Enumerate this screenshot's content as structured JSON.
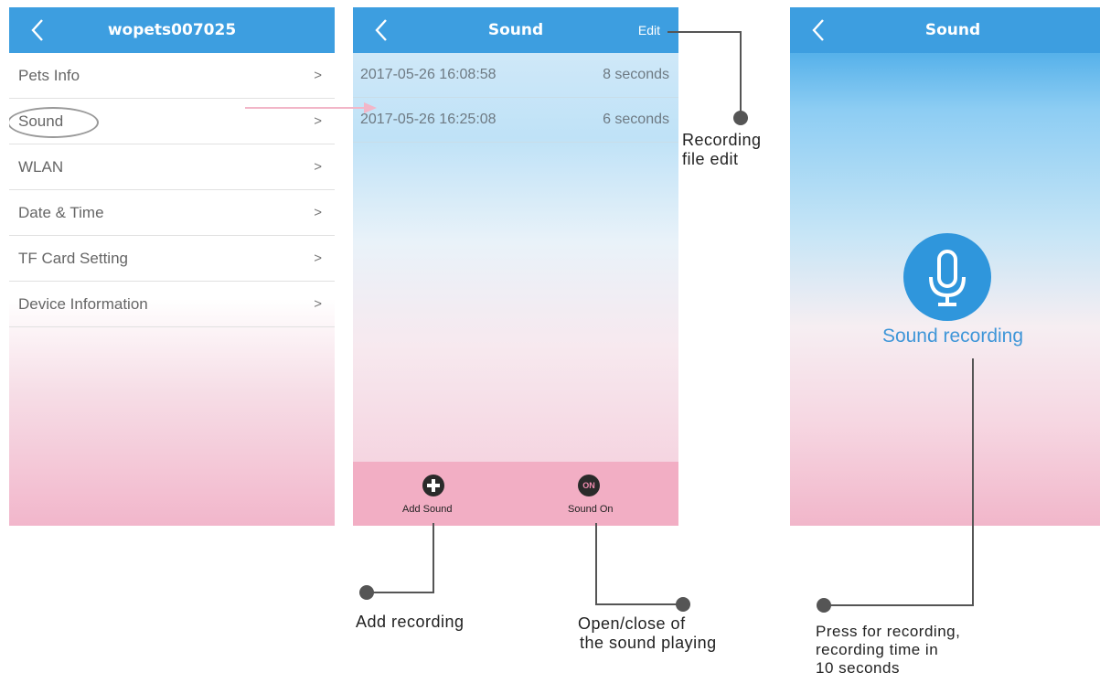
{
  "screen1": {
    "title": "wopets007025",
    "items": [
      {
        "label": "Pets Info"
      },
      {
        "label": "Sound"
      },
      {
        "label": "WLAN"
      },
      {
        "label": "Date & Time"
      },
      {
        "label": "TF Card Setting"
      },
      {
        "label": "Device Information"
      }
    ],
    "chevron": ">"
  },
  "screen2": {
    "title": "Sound",
    "edit_label": "Edit",
    "recordings": [
      {
        "date": "2017-05-26 16:08:58",
        "duration": "8 seconds"
      },
      {
        "date": "2017-05-26 16:25:08",
        "duration": "6 seconds"
      }
    ],
    "add_sound_label": "Add Sound",
    "sound_on_label": "Sound On",
    "sound_on_icon_text": "ON"
  },
  "screen3": {
    "title": "Sound",
    "recording_label": "Sound recording"
  },
  "annotations": {
    "edit_line1": "Recording",
    "edit_line2": "file edit",
    "add": "Add recording",
    "sound_line1": "Open/close of",
    "sound_line2": "the sound playing",
    "press_line1": "Press for recording,",
    "press_line2": "recording  time in",
    "press_line3": "10 seconds"
  },
  "colors": {
    "topbar": "#3d9ee0",
    "bottombar": "#f2aec4",
    "highlight_arrow": "#f2b6c8",
    "mic": "#2f96dc"
  }
}
